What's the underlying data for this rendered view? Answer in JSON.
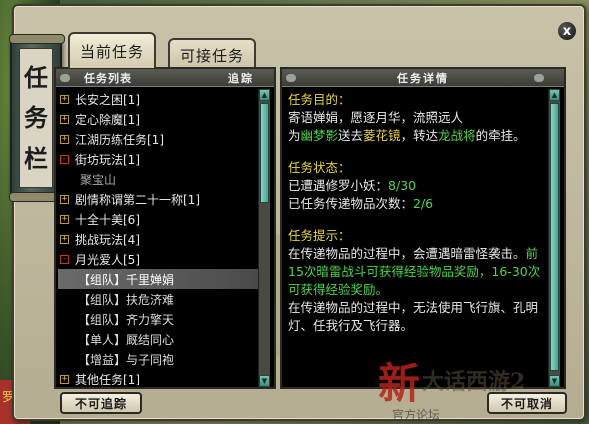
{
  "window": {
    "title_chars": [
      "任",
      "务",
      "栏"
    ],
    "close_label": "x"
  },
  "tabs": [
    {
      "label": "当前任务",
      "active": true
    },
    {
      "label": "可接任务",
      "active": false
    }
  ],
  "task_list": {
    "header_left": "任务列表",
    "header_right": "追踪",
    "items": [
      {
        "label": "长安之困[1]",
        "kind": "group",
        "expand": "+"
      },
      {
        "label": "定心除魔[1]",
        "kind": "group",
        "expand": "+"
      },
      {
        "label": "江湖历练任务[1]",
        "kind": "group",
        "expand": "+"
      },
      {
        "label": "街坊玩法[1]",
        "kind": "group",
        "expand": "-"
      },
      {
        "label": "聚宝山",
        "kind": "sub"
      },
      {
        "label": "剧情称谓第二十一称[1]",
        "kind": "group",
        "expand": "+"
      },
      {
        "label": "十全十美[6]",
        "kind": "group",
        "expand": "+"
      },
      {
        "label": "挑战玩法[4]",
        "kind": "group",
        "expand": "+"
      },
      {
        "label": "月光爱人[5]",
        "kind": "group",
        "expand": "-"
      },
      {
        "label": "【组队】千里婵娟",
        "kind": "child",
        "selected": true
      },
      {
        "label": "【组队】扶危济难",
        "kind": "child"
      },
      {
        "label": "【组队】齐力擎天",
        "kind": "child"
      },
      {
        "label": "【单人】厩结同心",
        "kind": "child"
      },
      {
        "label": "【增益】与子同袍",
        "kind": "child"
      },
      {
        "label": "其他任务[1]",
        "kind": "group",
        "expand": "+"
      }
    ]
  },
  "details": {
    "header": "任务详情",
    "objective_title": "任务目的：",
    "objective_line1": "寄语婵娟，愿逐月华，流照远人",
    "objective_pre": "为",
    "objective_target": "幽梦影",
    "objective_mid": "送去",
    "objective_item": "菱花镜",
    "objective_mid2": "，转达",
    "objective_npc": "龙战将",
    "objective_post": "的牵挂。",
    "status_title": "任务状态：",
    "status_line1_label": "已遭遇修罗小妖：",
    "status_line1_value": "8/30",
    "status_line2_label": "已任务传递物品次数：",
    "status_line2_value": "2/6",
    "hint_title": "任务提示：",
    "hint_line1": "在传递物品的过程中，会遭遇暗雷怪袭击。",
    "hint_green": "前15次暗雷战斗可获得经验物品奖励，16-30次可获得经验奖励。",
    "hint_line2": "在传递物品的过程中，无法使用飞行旗、孔明灯、任我行及飞行器。"
  },
  "buttons": {
    "untrack": "不可追踪",
    "cancel": "不可取消"
  },
  "logo": {
    "big": "新",
    "rest": "大话西游2",
    "sub": "官方论坛"
  },
  "backdrop": {
    "hint_text": "罗人"
  },
  "colors": {
    "highlight_yellow": "#e8d442",
    "highlight_green": "#4fd44f",
    "expand_gold": "#d8b84a",
    "collapse_red": "#e04a30"
  }
}
